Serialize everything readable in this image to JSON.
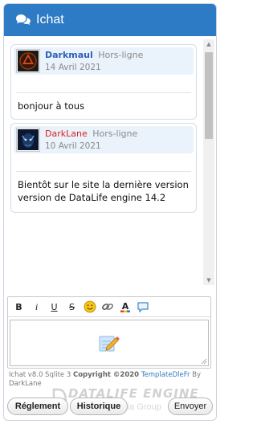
{
  "header": {
    "title": "Ichat",
    "icon": "chat-bubbles-icon",
    "color": "#2d7bc4"
  },
  "messages": [
    {
      "username": "Darkmaul",
      "username_color": "#2d5fb8",
      "status": "Hors-ligne",
      "date": "14 Avril 2021",
      "text": "bonjour à tous"
    },
    {
      "username": "DarkLane",
      "username_color": "#d9231b",
      "status": "Hors-ligne",
      "date": "10 Avril 2021",
      "text": "Bientôt sur le site la dernière version version de DataLife engine 14.2"
    }
  ],
  "toolbar": {
    "bold": "B",
    "italic": "i",
    "underline": "U",
    "strike": "S",
    "icons": [
      "smiley-icon",
      "link-icon",
      "text-color-icon",
      "quote-bubble-icon"
    ]
  },
  "footer": {
    "version": "Ichat v8.0 Sqlite 3",
    "copyright": "Copyright ©2020",
    "brand": "TemplateDleFr",
    "by": "By",
    "author": "DarkLane"
  },
  "buttons": {
    "rules": "Réglement",
    "history": "Historique",
    "send": "Envoyer"
  },
  "watermark": {
    "main": "DATALIFE ENGINE",
    "sub": "Softnews Media Group"
  }
}
